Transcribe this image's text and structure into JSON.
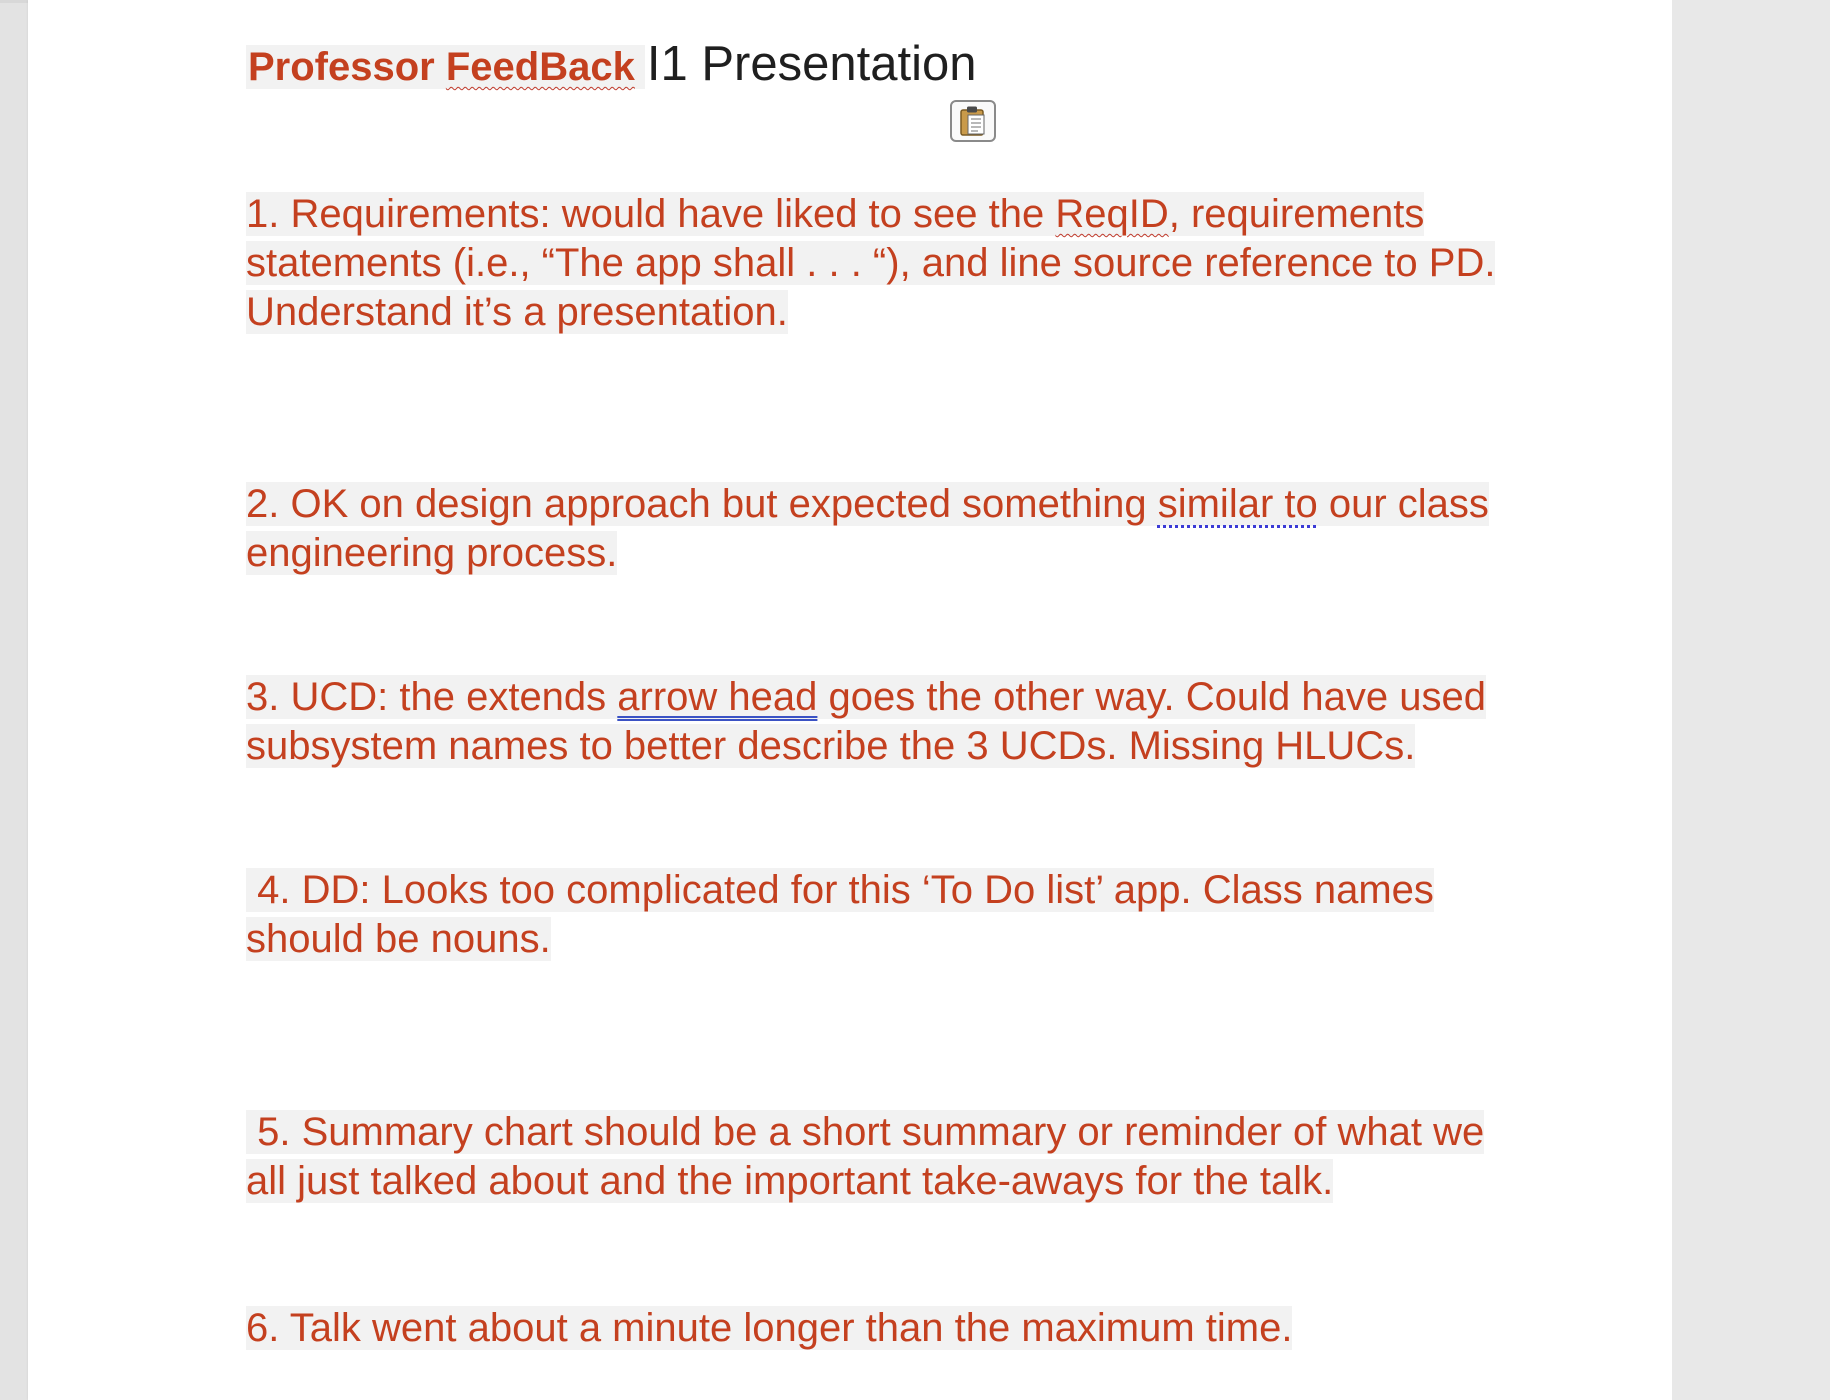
{
  "document": {
    "title_prefix": "Professor",
    "title_flagged": "FeedBack",
    "title_rest": "I1 Presentation",
    "paste_icon": "clipboard-icon",
    "items": [
      {
        "lines": [
          {
            "pre": "1. Requirements: would have liked to see the ",
            "flagged": "ReqID",
            "post": ", requirements"
          },
          {
            "text": "statements (i.e., “The app shall . . . “), and line source reference to PD."
          },
          {
            "text": "Understand it’s a presentation."
          }
        ]
      },
      {
        "lines": [
          {
            "pre": "2. OK on design approach but expected something ",
            "marked": "similar to",
            "post": " our class"
          },
          {
            "text": "engineering process."
          }
        ]
      },
      {
        "lines": [
          {
            "pre": "3. UCD: the extends ",
            "marked": "arrow head",
            "post": " goes the other way. Could have used"
          },
          {
            "text": "subsystem names to better describe the 3 UCDs. Missing HLUCs."
          }
        ]
      },
      {
        "lines": [
          {
            "text": " 4. DD: Looks too complicated for this ‘To Do list’ app. Class names"
          },
          {
            "text": "should be nouns."
          }
        ]
      },
      {
        "lines": [
          {
            "text": " 5. Summary chart should be a short summary or reminder of what we"
          },
          {
            "text": "all just talked about and the important take-aways for the talk."
          }
        ]
      },
      {
        "lines": [
          {
            "text": "6. Talk went about a minute longer than the maximum time."
          }
        ]
      }
    ]
  },
  "colors": {
    "comment_text": "#c4401f",
    "highlight": "#f2f2f2",
    "title_text": "#1f1f1f"
  }
}
